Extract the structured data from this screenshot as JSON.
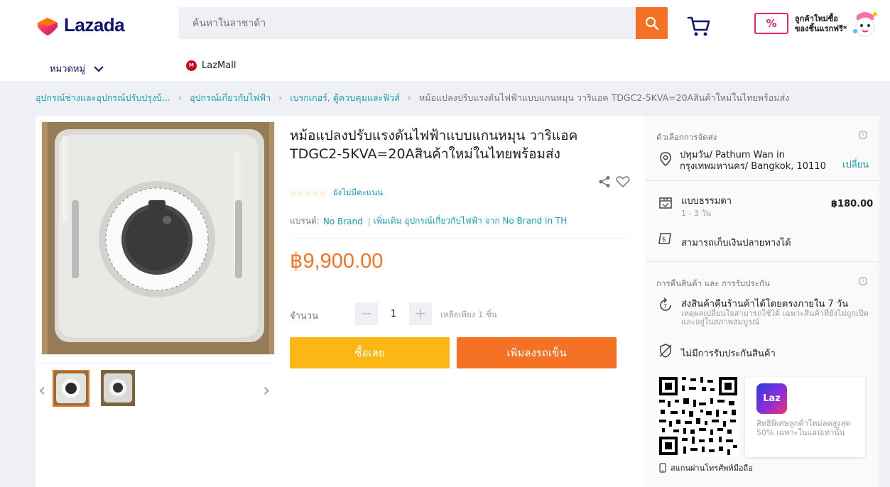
{
  "header": {
    "logo_text": "Lazada",
    "search_placeholder": "ค้นหาในลาซาด้า",
    "promo_badge": "%",
    "promo_text_line1": "ลูกค้าใหม่ซื้อ",
    "promo_text_line2": "ของชิ้นแรกฟรี*",
    "category_label": "หมวดหมู่",
    "lazmall_label": "LazMall",
    "lazmall_badge": "M"
  },
  "breadcrumb": {
    "items": [
      "อุปกรณ์ช่างและอุปกรณ์ปรับปรุงบ้...",
      "อุปกรณ์เกี่ยวกับไฟฟ้า",
      "เบรกเกอร์, ตู้ควบคุมและฟิวส์"
    ],
    "current": "หม้อแปลงปรับแรงดันไฟฟ้าแบบแกนหมุน วาริแอค TDGC2-5KVA=20Aสินค้าใหม่ในไทยพร้อมส่ง"
  },
  "product": {
    "title": "หม้อแปลงปรับแรงดันไฟฟ้าแบบแกนหมุน วาริแอค TDGC2-5KVA=20Aสินค้าใหม่ในไทยพร้อมส่ง",
    "stars": "☆☆☆☆☆",
    "rating_text": "ยังไม่มีคะแนน",
    "brand_label": "แบรนด์:",
    "brand_value": "No Brand",
    "more_link": "เพิ่มเติม อุปกรณ์เกี่ยวกับไฟฟ้า จาก No Brand in TH",
    "price": "฿9,900.00",
    "qty_label": "จำนวน",
    "qty_value": "1",
    "qty_minus": "−",
    "qty_plus": "+",
    "stock_text": "เหลือเพียง 1 ชิ้น",
    "buy_now": "ซื้อเลย",
    "add_to_cart": "เพิ่มลงรถเข็น"
  },
  "gallery": {
    "prev": "‹",
    "next": "›",
    "thumb_count": 2,
    "active_thumb": 0
  },
  "sidebar": {
    "delivery_title": "ตัวเลือกการจัดส่ง",
    "address": "ปทุมวัน/ Pathum Wan in กรุงเทพมหานคร/ Bangkok, 10110",
    "change_label": "เปลี่ยน",
    "ship_method": "แบบธรรมดา",
    "ship_days": "1 - 3 วัน",
    "ship_price": "฿180.00",
    "cod_label": "สามารถเก็บเงินปลายทางได้",
    "return_title": "การคืนสินค้า และ การรับประกัน",
    "return_main": "ส่งสินค้าคืนร้านค้าได้โดยตรงภายใน 7 วัน",
    "return_sub": "เหตุผลเปลี่ยนใจสามารถใช้ได้ เฉพาะสินค้าที่ยังไม่ถูกเปิดและอยู่ในสภาพสมบูรณ์",
    "warranty": "ไม่มีการรับประกันสินค้า",
    "scan_label": "สแกนผ่านโทรศัพท์มือถือ",
    "app_icon_text": "Laz",
    "app_text": "สิทธิพิเศษลูกค้าใหม่ลดสูงสุด 50% เฉพาะในแอปเท่านั้น"
  },
  "colors": {
    "accent": "#f57224",
    "buy": "#fcb714",
    "link": "#1a9cb7",
    "brand_navy": "#0f146d"
  }
}
